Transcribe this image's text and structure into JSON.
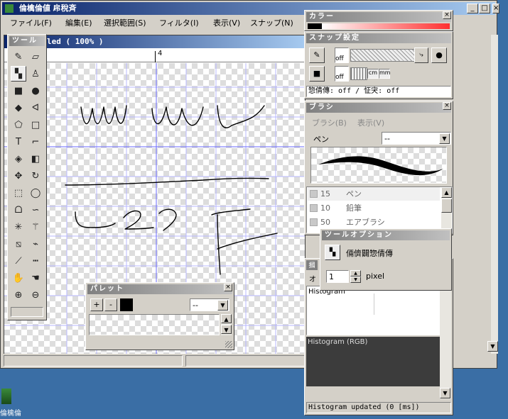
{
  "app": {
    "title": "倫檎倫値 帍稅斉",
    "doc_title": "led ( 100% )",
    "ruler_mark": "4",
    "menu": [
      "ファイル(F)",
      "編集(E)",
      "選択範囲(S)",
      "フィルタ(I)",
      "表示(V)",
      "スナップ(N)"
    ],
    "window_buttons": [
      "_",
      "□",
      "×"
    ]
  },
  "toolbox": {
    "title": "ツール"
  },
  "color_palette": {
    "title": "カラー"
  },
  "snap_palette": {
    "title": "スナップ設定",
    "off1": "off",
    "off2": "off",
    "unit_cm": "cm",
    "unit_mm": "mm",
    "status": "惣倩傳: off / 怔宊: off"
  },
  "brush_palette": {
    "title": "ブラシ",
    "menu": [
      "ブラシ(B)",
      "表示(V)"
    ],
    "label_pen": "ペン",
    "select_value": "--",
    "list": [
      {
        "size": "15",
        "name": "ペン"
      },
      {
        "size": "10",
        "name": "鉛筆"
      },
      {
        "size": "50",
        "name": "エアブラシ"
      }
    ]
  },
  "tool_option": {
    "title": "ツールオプション",
    "mode_label": "倆儕闢惣倩傳",
    "value": "1",
    "unit": "pixel"
  },
  "histogram": {
    "small_tab": "オ",
    "small_tab2": "摑",
    "label1": "Histogram",
    "label2": "Histogram (RGB)",
    "status": "Histogram updated (0 [ms])"
  },
  "palette_window": {
    "title": "パレット",
    "plus": "+",
    "minus": "-",
    "select_value": "--"
  },
  "desktop": {
    "icon_label": "倫檎倫"
  },
  "colors": {
    "titlebar": "#0a246a",
    "desktop": "#3a6ea5",
    "face": "#d4d0c8"
  }
}
